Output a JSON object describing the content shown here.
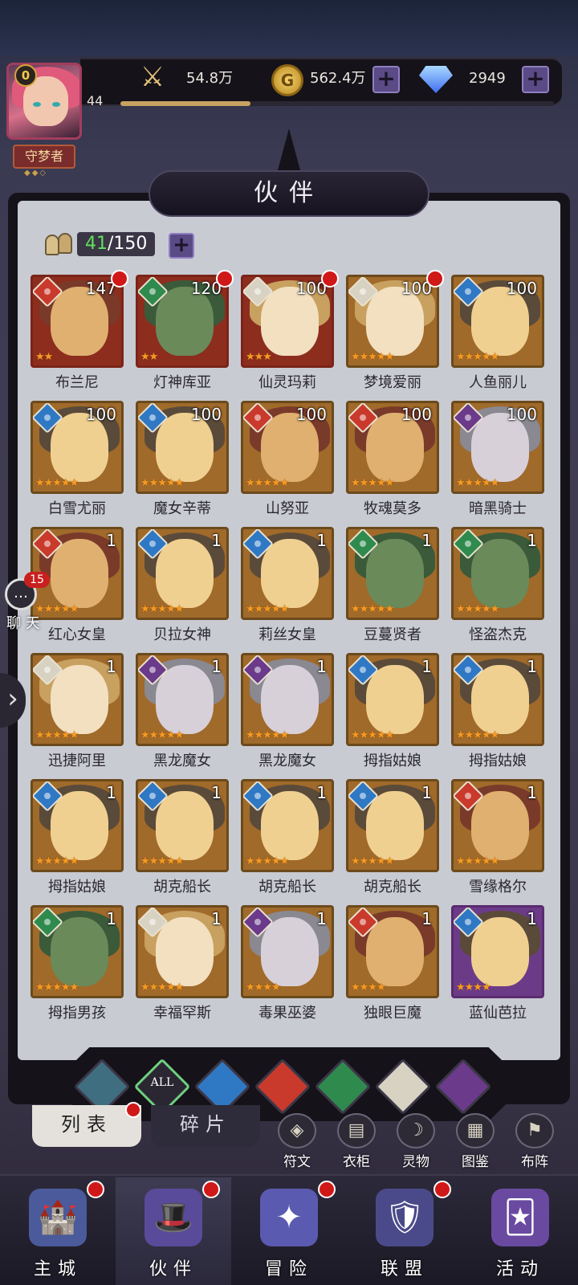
{
  "player": {
    "level_badge": "0",
    "level": "44",
    "rank": "守梦者",
    "xp_fraction": 0.3
  },
  "resources": {
    "power": "54.8万",
    "gold": "562.4万",
    "gems": "2949"
  },
  "panel": {
    "title": "伙伴",
    "count_current": "41",
    "count_total": "/150"
  },
  "chat": {
    "badge": "15",
    "label": "聊 天"
  },
  "heroes": [
    {
      "name": "布兰尼",
      "level": "147",
      "element": "fire",
      "stars": 2,
      "red_dot": true,
      "frame": "red"
    },
    {
      "name": "灯神库亚",
      "level": "120",
      "element": "wind",
      "stars": 2,
      "red_dot": true,
      "frame": "red"
    },
    {
      "name": "仙灵玛莉",
      "level": "100",
      "element": "light",
      "stars": 3,
      "red_dot": true,
      "frame": "red"
    },
    {
      "name": "梦境爱丽",
      "level": "100",
      "element": "light",
      "stars": 5,
      "red_dot": true,
      "frame": "gold"
    },
    {
      "name": "人鱼丽儿",
      "level": "100",
      "element": "water",
      "stars": 5,
      "red_dot": false,
      "frame": "gold"
    },
    {
      "name": "白雪尤丽",
      "level": "100",
      "element": "water",
      "stars": 5,
      "red_dot": false,
      "frame": "gold"
    },
    {
      "name": "魔女辛蒂",
      "level": "100",
      "element": "water",
      "stars": 5,
      "red_dot": false,
      "frame": "gold"
    },
    {
      "name": "山努亚",
      "level": "100",
      "element": "fire",
      "stars": 5,
      "red_dot": false,
      "frame": "gold"
    },
    {
      "name": "牧魂莫多",
      "level": "100",
      "element": "fire",
      "stars": 5,
      "red_dot": false,
      "frame": "gold"
    },
    {
      "name": "暗黑骑士",
      "level": "100",
      "element": "dark",
      "stars": 5,
      "red_dot": false,
      "frame": "gold"
    },
    {
      "name": "红心女皇",
      "level": "1",
      "element": "fire",
      "stars": 5,
      "red_dot": false,
      "frame": "gold"
    },
    {
      "name": "贝拉女神",
      "level": "1",
      "element": "water",
      "stars": 5,
      "red_dot": false,
      "frame": "gold"
    },
    {
      "name": "莉丝女皇",
      "level": "1",
      "element": "water",
      "stars": 5,
      "red_dot": false,
      "frame": "gold"
    },
    {
      "name": "豆蔓贤者",
      "level": "1",
      "element": "wind",
      "stars": 5,
      "red_dot": false,
      "frame": "gold"
    },
    {
      "name": "怪盗杰克",
      "level": "1",
      "element": "wind",
      "stars": 5,
      "red_dot": false,
      "frame": "gold"
    },
    {
      "name": "迅捷阿里",
      "level": "1",
      "element": "light",
      "stars": 5,
      "red_dot": false,
      "frame": "gold"
    },
    {
      "name": "黑龙魔女",
      "level": "1",
      "element": "dark",
      "stars": 5,
      "red_dot": false,
      "frame": "gold"
    },
    {
      "name": "黑龙魔女",
      "level": "1",
      "element": "dark",
      "stars": 5,
      "red_dot": false,
      "frame": "gold"
    },
    {
      "name": "拇指姑娘",
      "level": "1",
      "element": "water",
      "stars": 5,
      "red_dot": false,
      "frame": "gold"
    },
    {
      "name": "拇指姑娘",
      "level": "1",
      "element": "water",
      "stars": 5,
      "red_dot": false,
      "frame": "gold"
    },
    {
      "name": "拇指姑娘",
      "level": "1",
      "element": "water",
      "stars": 5,
      "red_dot": false,
      "frame": "gold"
    },
    {
      "name": "胡克船长",
      "level": "1",
      "element": "water",
      "stars": 5,
      "red_dot": false,
      "frame": "gold"
    },
    {
      "name": "胡克船长",
      "level": "1",
      "element": "water",
      "stars": 5,
      "red_dot": false,
      "frame": "gold"
    },
    {
      "name": "胡克船长",
      "level": "1",
      "element": "water",
      "stars": 5,
      "red_dot": false,
      "frame": "gold"
    },
    {
      "name": "雪缘格尔",
      "level": "1",
      "element": "fire",
      "stars": 5,
      "red_dot": false,
      "frame": "gold"
    },
    {
      "name": "拇指男孩",
      "level": "1",
      "element": "wind",
      "stars": 5,
      "red_dot": false,
      "frame": "gold"
    },
    {
      "name": "幸福罕斯",
      "level": "1",
      "element": "light",
      "stars": 5,
      "red_dot": false,
      "frame": "gold"
    },
    {
      "name": "毒果巫婆",
      "level": "1",
      "element": "dark",
      "stars": 4,
      "red_dot": false,
      "frame": "gold"
    },
    {
      "name": "独眼巨魔",
      "level": "1",
      "element": "fire",
      "stars": 4,
      "red_dot": false,
      "frame": "gold"
    },
    {
      "name": "蓝仙芭拉",
      "level": "1",
      "element": "water",
      "stars": 4,
      "red_dot": false,
      "frame": "purple"
    }
  ],
  "filters": [
    {
      "id": "filter-mystic",
      "label": "",
      "icon": "mystic-element-icon",
      "selected": false
    },
    {
      "id": "filter-all",
      "label": "ALL",
      "icon": "all-icon",
      "selected": true
    },
    {
      "id": "filter-water",
      "label": "",
      "icon": "water-element-icon",
      "selected": false
    },
    {
      "id": "filter-fire",
      "label": "",
      "icon": "fire-element-icon",
      "selected": false
    },
    {
      "id": "filter-wind",
      "label": "",
      "icon": "wind-element-icon",
      "selected": false
    },
    {
      "id": "filter-light",
      "label": "",
      "icon": "light-element-icon",
      "selected": false
    },
    {
      "id": "filter-dark",
      "label": "",
      "icon": "dark-element-icon",
      "selected": false
    }
  ],
  "tabs": {
    "list": "列表",
    "fragments": "碎片"
  },
  "subnav": [
    "符文",
    "衣柜",
    "灵物",
    "图鉴",
    "布阵"
  ],
  "nav": [
    "主城",
    "伙伴",
    "冒险",
    "联盟",
    "活动"
  ],
  "colors": {
    "accent_purple": "#5a4a86",
    "notification_red": "#d01818",
    "star_orange": "#f59a23",
    "count_green": "#5fe05c"
  }
}
